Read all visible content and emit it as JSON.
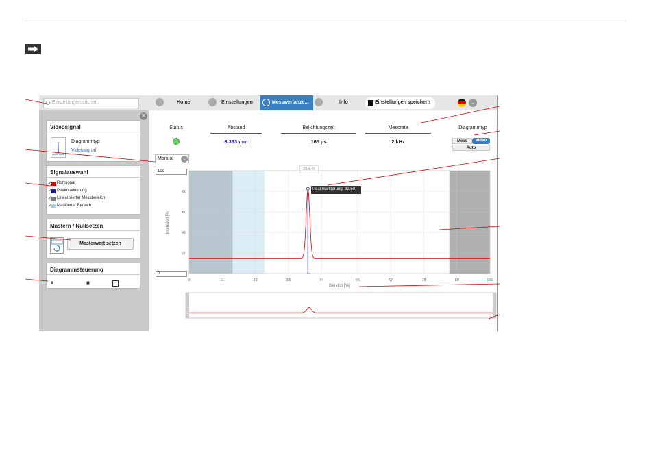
{
  "search": {
    "placeholder": "Einstellungen suchen"
  },
  "nav": {
    "home": "Home",
    "settings": "Einstellungen",
    "active": "Messwertanze...",
    "info": "Info",
    "save": "Einstellungen speichern"
  },
  "panels": {
    "video": {
      "title": "Videosignal",
      "type_label": "Diagrammtyp",
      "type_value": "Videosignal"
    },
    "signals": {
      "title": "Signalauswahl",
      "items": [
        {
          "label": "Rohsignal",
          "color": "#e00000"
        },
        {
          "label": "Peakmarkierung",
          "color": "#1a1aaa"
        },
        {
          "label": "Linearisierter Messbereich",
          "color": "#7a7a7a"
        },
        {
          "label": "Maskierter Bereich",
          "color": "#a9d4ea"
        }
      ]
    },
    "master": {
      "title": "Mastern / Nullsetzen",
      "button": "Masterwert setzen"
    },
    "control": {
      "title": "Diagrammsteuerung"
    }
  },
  "status": {
    "status_label": "Status",
    "distance_label": "Abstand",
    "distance_value": "8.313 mm",
    "exposure_label": "Belichtungszeit",
    "exposure_value": "165 µs",
    "rate_label": "Messrate",
    "rate_value": "2 kHz",
    "dtype_label": "Diagrammtyp",
    "dtype_mess": "Mess",
    "dtype_video": "Video",
    "dtype_auto": "Auto"
  },
  "chart_controls": {
    "scale_mode": "Manual",
    "max_value": "100",
    "min_value": "0",
    "peak_percent": "39.5 %",
    "tooltip": "Peakmarkierung: 82.50"
  },
  "chart_data": {
    "type": "line",
    "xlabel": "Bereich [%]",
    "ylabel": "Intensität [%]",
    "xlim": [
      0,
      100
    ],
    "ylim": [
      0,
      100
    ],
    "x_ticks": [
      "0",
      "11",
      "22",
      "33",
      "44",
      "56",
      "67",
      "78",
      "89",
      "100"
    ],
    "y_ticks": [
      "20",
      "40",
      "60",
      "80"
    ],
    "baseline": 15,
    "peak": {
      "x": 39.5,
      "y": 82.5,
      "width": 1.2
    },
    "lin_range": [
      0,
      14.5
    ],
    "masked_ranges": [
      [
        14.5,
        25
      ],
      [
        86.5,
        100
      ]
    ],
    "colors": {
      "signal": "#e00000",
      "peak": "#1a1aaa",
      "lin": "#7a7a7a",
      "mask_light": "#a9d4ea",
      "mask_dark": "#b0b0b0"
    }
  }
}
